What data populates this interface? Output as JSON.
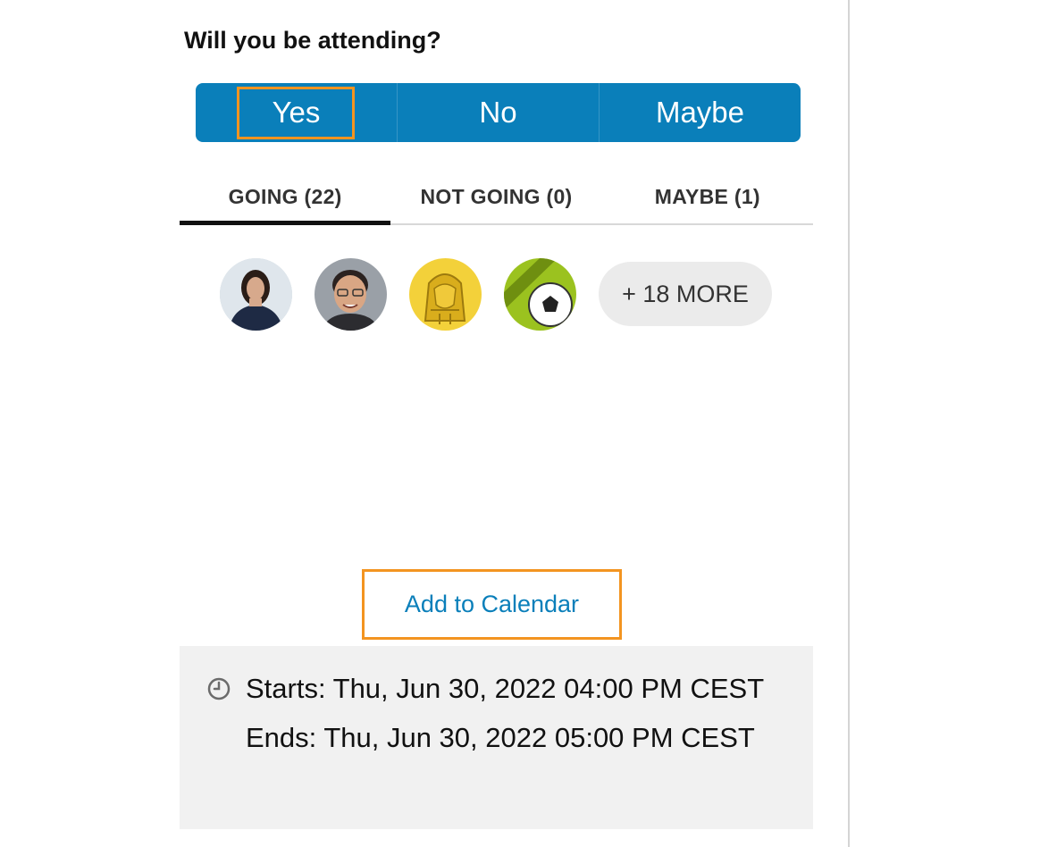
{
  "question": "Will you be attending?",
  "rsvp": {
    "options": [
      "Yes",
      "No",
      "Maybe"
    ]
  },
  "tabs": [
    "GOING (22)",
    "NOT GOING (0)",
    "MAYBE (1)"
  ],
  "attendees": {
    "avatars": [
      "avatar-woman",
      "avatar-man",
      "avatar-gold-sphinx",
      "avatar-green-soccer"
    ],
    "more_label": "+ 18 MORE"
  },
  "calendar": {
    "add_label": "Add to Calendar"
  },
  "time": {
    "starts": "Starts: Thu, Jun 30, 2022 04:00 PM CEST",
    "ends": "Ends: Thu, Jun 30, 2022 05:00 PM CEST"
  },
  "colors": {
    "accent": "#0a7fba",
    "highlight": "#f39420"
  }
}
